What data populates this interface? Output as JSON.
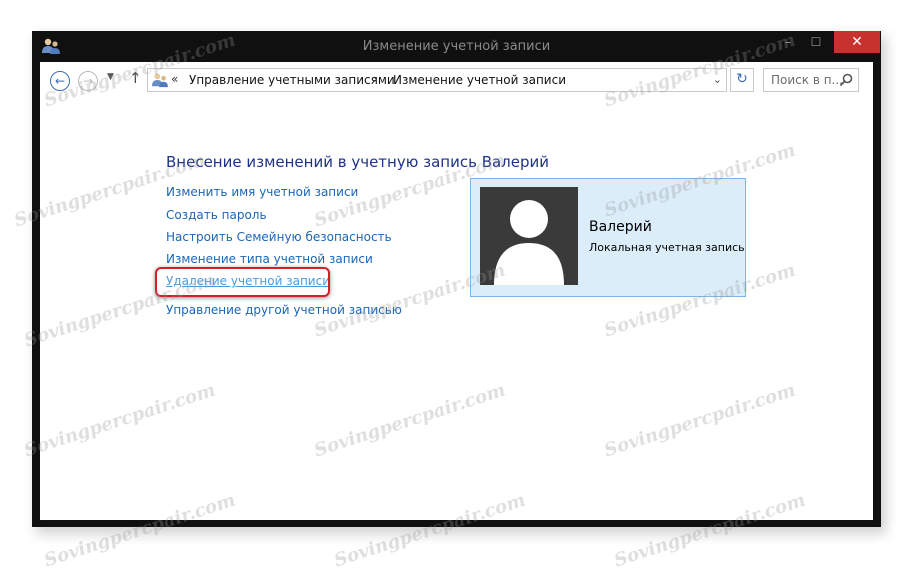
{
  "window": {
    "title": "Изменение учетной записи",
    "minimize_label": "–",
    "maximize_label": "☐",
    "close_label": "✕"
  },
  "toolbar": {
    "back_label": "←",
    "forward_label": "→",
    "recent_label": "▼",
    "up_label": "↑",
    "address_chevron": "«",
    "breadcrumbs": [
      "Управление учетными записями",
      "Изменение учетной записи"
    ],
    "breadcrumb_separator": "›",
    "address_dropdown": "⌄",
    "refresh_label": "↻",
    "search_placeholder": "Поиск в п..."
  },
  "main": {
    "heading": "Внесение изменений в учетную запись Валерий",
    "links": [
      "Изменить имя учетной записи",
      "Создать пароль",
      "Настроить Семейную безопасность",
      "Изменение типа учетной записи",
      "Удаление учетной записи",
      "Управление другой учетной записью"
    ],
    "highlighted_link_index": 4
  },
  "account_card": {
    "name": "Валерий",
    "type": "Локальная учетная запись"
  },
  "watermark": "Sovingpercpair.com",
  "colors": {
    "link": "#1b66b8",
    "heading": "#1e3287",
    "card_bg": "#dcedfa",
    "highlight_border": "#d31f26",
    "close_button": "#c7322e"
  },
  "icons": [
    "users-icon",
    "back-icon",
    "forward-icon",
    "up-arrow-icon",
    "refresh-icon",
    "search-icon",
    "user-avatar-icon"
  ]
}
